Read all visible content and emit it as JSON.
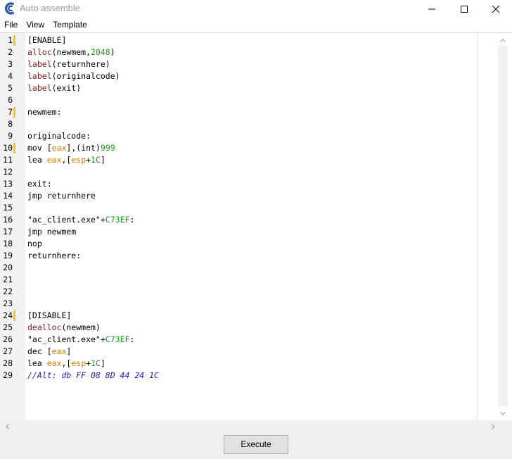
{
  "window": {
    "title": "Auto assemble",
    "controls": [
      "minimize",
      "maximize",
      "close"
    ]
  },
  "menu": {
    "items": [
      "File",
      "View",
      "Template"
    ]
  },
  "editor": {
    "line_numbers": [
      "1",
      "2",
      "3",
      "4",
      "5",
      "6",
      "7",
      "8",
      "9",
      "10",
      "11",
      "12",
      "13",
      "14",
      "15",
      "16",
      "17",
      "18",
      "19",
      "20",
      "21",
      "22",
      "23",
      "24",
      "25",
      "26",
      "27",
      "28",
      "29"
    ],
    "marker_color": "#f0d000",
    "marked_lines": [
      1,
      7,
      10,
      24
    ],
    "syntax_colors": {
      "function": "#8b1a1a",
      "register": "#e07800",
      "number": "#1a9a1a",
      "comment": "#2020d0"
    },
    "lines": [
      [
        {
          "t": "[ENABLE]",
          "c": "plain"
        }
      ],
      [
        {
          "t": "alloc",
          "c": "fn"
        },
        {
          "t": "(newmem,",
          "c": "plain"
        },
        {
          "t": "2048",
          "c": "num"
        },
        {
          "t": ")",
          "c": "plain"
        }
      ],
      [
        {
          "t": "label",
          "c": "fn"
        },
        {
          "t": "(returnhere)",
          "c": "plain"
        }
      ],
      [
        {
          "t": "label",
          "c": "fn"
        },
        {
          "t": "(originalcode)",
          "c": "plain"
        }
      ],
      [
        {
          "t": "label",
          "c": "fn"
        },
        {
          "t": "(exit)",
          "c": "plain"
        }
      ],
      [],
      [
        {
          "t": "newmem:",
          "c": "plain"
        }
      ],
      [],
      [
        {
          "t": "originalcode:",
          "c": "plain"
        }
      ],
      [
        {
          "t": "mov",
          "c": "plain"
        },
        {
          "t": " [",
          "c": "plain"
        },
        {
          "t": "eax",
          "c": "reg"
        },
        {
          "t": "],(int)",
          "c": "plain"
        },
        {
          "t": "999",
          "c": "num"
        }
      ],
      [
        {
          "t": "lea",
          "c": "plain"
        },
        {
          "t": " ",
          "c": "plain"
        },
        {
          "t": "eax",
          "c": "reg"
        },
        {
          "t": ",[",
          "c": "plain"
        },
        {
          "t": "esp",
          "c": "reg"
        },
        {
          "t": "+",
          "c": "plain"
        },
        {
          "t": "1C",
          "c": "num"
        },
        {
          "t": "]",
          "c": "plain"
        }
      ],
      [],
      [
        {
          "t": "exit:",
          "c": "plain"
        }
      ],
      [
        {
          "t": "jmp",
          "c": "plain"
        },
        {
          "t": " returnhere",
          "c": "plain"
        }
      ],
      [],
      [
        {
          "t": "\"ac_client.exe\"",
          "c": "plain"
        },
        {
          "t": "+",
          "c": "plain"
        },
        {
          "t": "C73EF",
          "c": "num"
        },
        {
          "t": ":",
          "c": "plain"
        }
      ],
      [
        {
          "t": "jmp",
          "c": "plain"
        },
        {
          "t": " newmem",
          "c": "plain"
        }
      ],
      [
        {
          "t": "nop",
          "c": "plain"
        }
      ],
      [
        {
          "t": "returnhere:",
          "c": "plain"
        }
      ],
      [],
      [],
      [],
      [],
      [
        {
          "t": "[DISABLE]",
          "c": "plain"
        }
      ],
      [
        {
          "t": "dealloc",
          "c": "fn"
        },
        {
          "t": "(newmem)",
          "c": "plain"
        }
      ],
      [
        {
          "t": "\"ac_client.exe\"",
          "c": "plain"
        },
        {
          "t": "+",
          "c": "plain"
        },
        {
          "t": "C73EF",
          "c": "num"
        },
        {
          "t": ":",
          "c": "plain"
        }
      ],
      [
        {
          "t": "dec",
          "c": "plain"
        },
        {
          "t": " [",
          "c": "plain"
        },
        {
          "t": "eax",
          "c": "reg"
        },
        {
          "t": "]",
          "c": "plain"
        }
      ],
      [
        {
          "t": "lea",
          "c": "plain"
        },
        {
          "t": " ",
          "c": "plain"
        },
        {
          "t": "eax",
          "c": "reg"
        },
        {
          "t": ",[",
          "c": "plain"
        },
        {
          "t": "esp",
          "c": "reg"
        },
        {
          "t": "+",
          "c": "plain"
        },
        {
          "t": "1C",
          "c": "num"
        },
        {
          "t": "]",
          "c": "plain"
        }
      ],
      [
        {
          "t": "//Alt: db FF 08 8D 44 24 1C",
          "c": "cmt"
        }
      ]
    ]
  },
  "footer": {
    "execute_label": "Execute"
  }
}
